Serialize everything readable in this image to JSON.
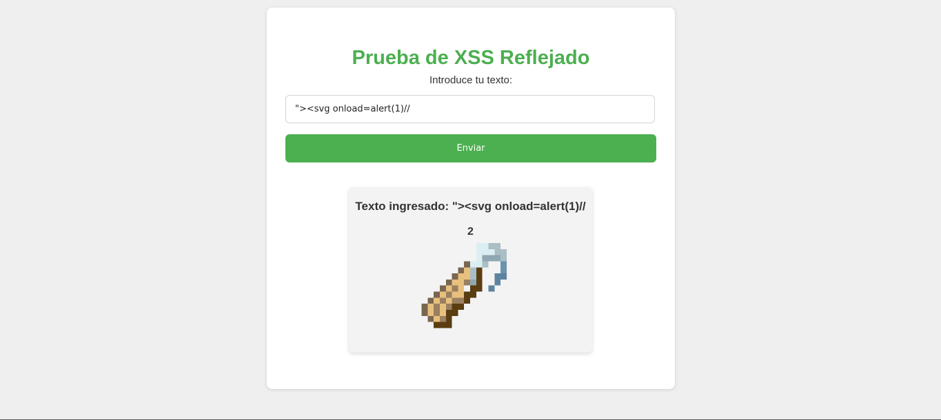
{
  "page": {
    "title": "Prueba de XSS Reflejado",
    "input_label": "Introduce tu texto:",
    "input_value": "\"><svg onload=alert(1)//",
    "submit_label": "Enviar"
  },
  "result": {
    "text": "Texto ingresado: \"><svg onload=alert(1)//",
    "count": "2",
    "item_icon": "lead-item-icon"
  },
  "colors": {
    "accent": "#4caf50",
    "background": "#efefef",
    "card": "#ffffff",
    "result_panel": "#f3f3f3"
  }
}
